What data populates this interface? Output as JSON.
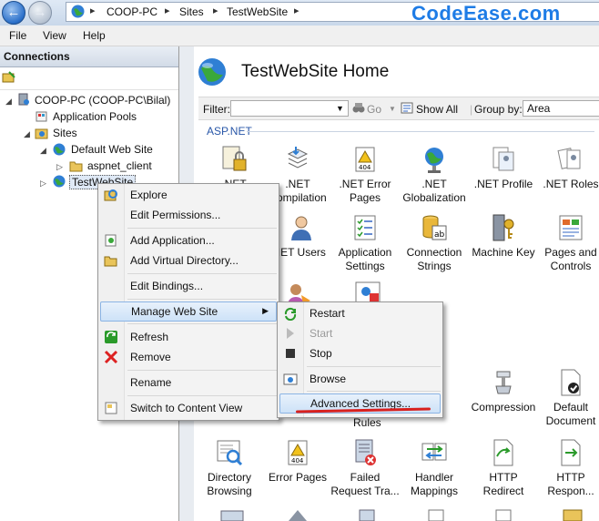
{
  "breadcrumbs": [
    "COOP-PC",
    "Sites",
    "TestWebSite"
  ],
  "watermark": "CodeEase.com",
  "menu": [
    "File",
    "View",
    "Help"
  ],
  "connections": {
    "title": "Connections",
    "tree": [
      {
        "label": "COOP-PC (COOP-PC\\Bilal)"
      },
      {
        "label": "Application Pools"
      },
      {
        "label": "Sites"
      },
      {
        "label": "Default Web Site"
      },
      {
        "label": "aspnet_client"
      },
      {
        "label": "TestWebSite"
      }
    ]
  },
  "main": {
    "title": "TestWebSite Home",
    "filter_label": "Filter:",
    "go_label": "Go",
    "show_all_label": "Show All",
    "group_by_label": "Group by:",
    "group_by_value": "Area",
    "section": "ASP.NET",
    "features_row1": [
      ".NET",
      ".NET Compilation",
      ".NET Error Pages",
      ".NET Globalization",
      ".NET Profile",
      ".NET Roles"
    ],
    "features_row2": [
      ".NET Users",
      "Application Settings",
      "Connection Strings",
      "Machine Key",
      "Pages and Controls"
    ],
    "features_row3": [
      "Compression",
      "Default Document"
    ],
    "features_row3_partial": "Rules",
    "features_row4": [
      "Directory Browsing",
      "Error Pages",
      "Failed Request Tra...",
      "Handler Mappings",
      "HTTP Redirect",
      "HTTP Respon..."
    ]
  },
  "context_menu": {
    "items": [
      "Explore",
      "Edit Permissions...",
      "Add Application...",
      "Add Virtual Directory...",
      "Edit Bindings...",
      "Manage Web Site",
      "Refresh",
      "Remove",
      "Rename",
      "Switch to Content View"
    ]
  },
  "submenu": {
    "items": [
      "Restart",
      "Start",
      "Stop",
      "Browse",
      "Advanced Settings..."
    ]
  },
  "colors": {
    "highlight_underline": "#d8201e",
    "watermark": "#1e7ce6",
    "section_header": "#2957a8"
  }
}
